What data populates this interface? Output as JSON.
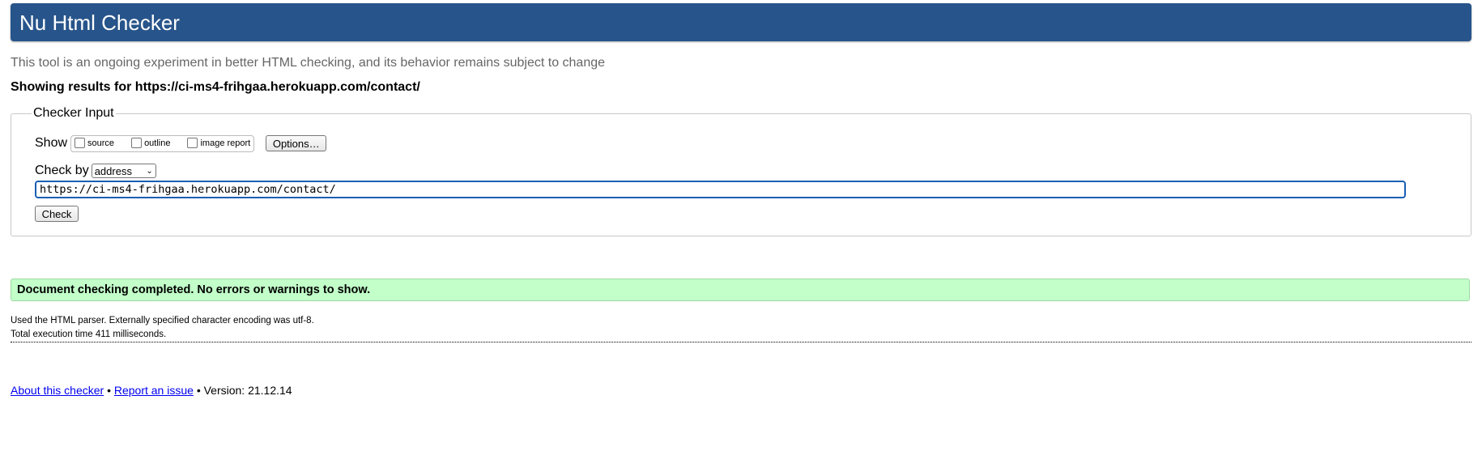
{
  "header": {
    "title": "Nu Html Checker"
  },
  "subtitle": "This tool is an ongoing experiment in better HTML checking, and its behavior remains subject to change",
  "showing_results": "Showing results for https://ci-ms4-frihgaa.herokuapp.com/contact/",
  "checker_input": {
    "legend": "Checker Input",
    "show_label": "Show",
    "checkboxes": [
      {
        "label": "source",
        "checked": false
      },
      {
        "label": "outline",
        "checked": false
      },
      {
        "label": "image report",
        "checked": false
      }
    ],
    "options_button": "Options…",
    "check_by_label": "Check by",
    "check_by_selected": "address",
    "url_value": "https://ci-ms4-frihgaa.herokuapp.com/contact/",
    "check_button": "Check"
  },
  "result": {
    "message": "Document checking completed. No errors or warnings to show.",
    "color": "#c2ffc9"
  },
  "info": {
    "parser": "Used the HTML parser. Externally specified character encoding was utf-8.",
    "execution": "Total execution time 411 milliseconds."
  },
  "footer": {
    "about": "About this checker",
    "separator": "•",
    "report": "Report an issue",
    "version": "Version: 21.12.14"
  },
  "colors": {
    "header": "#27548a",
    "link": "#0000ee",
    "input_focus": "#1a5fb4"
  }
}
